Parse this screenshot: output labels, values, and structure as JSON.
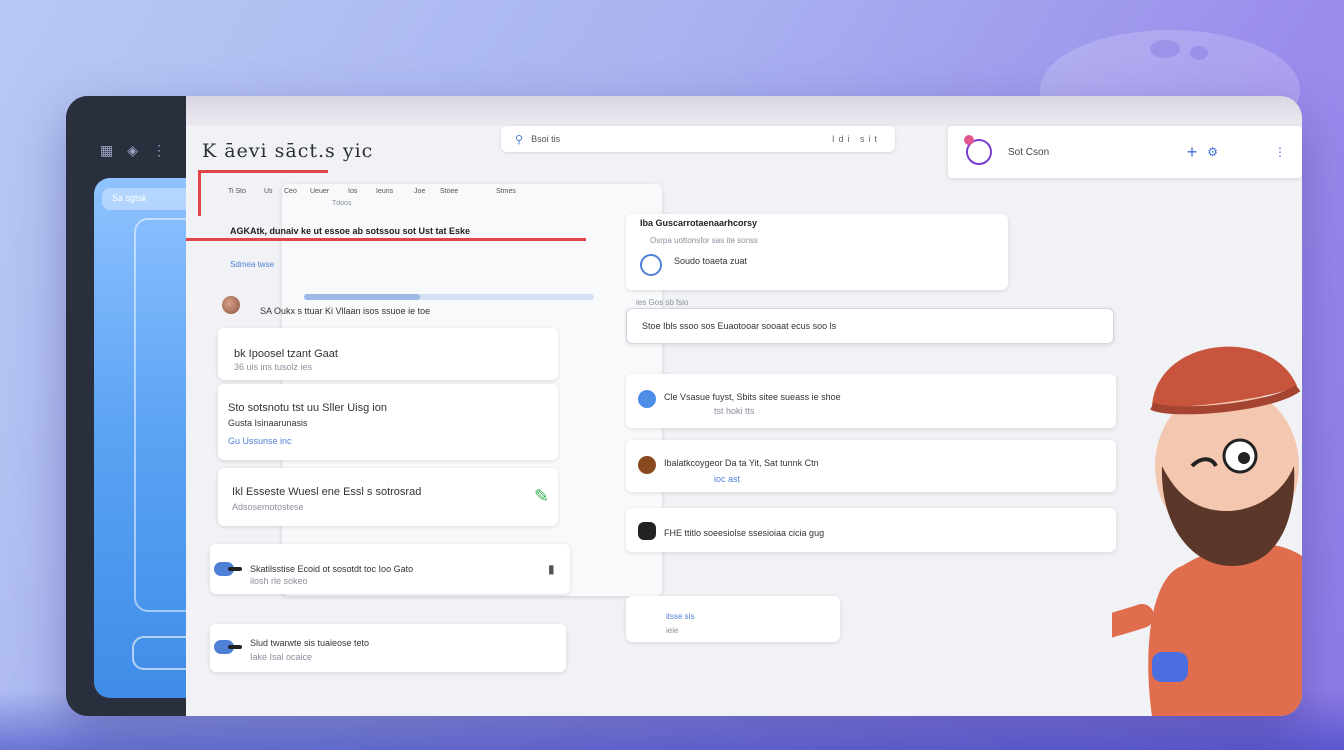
{
  "colors": {
    "accent": "#4f80d8",
    "highlight": "#e0454a",
    "success": "#37b24d"
  },
  "app": {
    "title": "K āevi sāct.s yic"
  },
  "search": {
    "icon": "search-icon",
    "placeholder": "Bsoi tis",
    "right": "Idi sit"
  },
  "user": {
    "name": "Sot Cson",
    "add_icon": "plus-icon",
    "settings_icon": "settings-icon",
    "more_icon": "more-icon"
  },
  "left_sidebar": {
    "top_label": "Sa sgtsk"
  },
  "list_tabs": [
    "Ti Sto",
    "Us",
    "Ceo",
    "Ueuer",
    "Ios",
    "Ieuns",
    "Joe",
    "Stoee",
    "Stmes"
  ],
  "list_subtitle": "Tdoos",
  "list_highlight": "AGKAtk, dunaiv ke ut essoe ab sotssou sot Ust tat Eske",
  "list_meta": "Sdmea twse",
  "list_items": [
    {
      "title": "SA Oukx s ttuar Ki Vllaan isos ssuoe ie toe",
      "sub": ""
    },
    {
      "title": "bk Ipoosel tzant Gaat",
      "sub": "36 uis ins tusolz ies"
    },
    {
      "title": "Sto sotsnotu tst uu Sller Uisg ion",
      "sub": "Gusta Isinaarunasis",
      "meta": "Gu Ussunse inc"
    },
    {
      "title": "Ikl Esseste Wuesl ene Essl s sotrosrad",
      "sub": "Adsosemotostese"
    }
  ],
  "left_cards": [
    {
      "title": "Skatilsstise Ecoid ot sosotdt toc Ioo Gato",
      "sub": "ilosh rle sokeo"
    },
    {
      "title": "Slud twarwte sis tuaieose teto",
      "sub": "Iake Isal ocaice"
    }
  ],
  "feed_header": {
    "title": "Iba Guscarrotaenaarhcorsy",
    "sub": "Osrpa uottonsfor sas ite sonss",
    "item": "Soudo toaeta zuat"
  },
  "feed_row_meta": "ies Gos sb fsio",
  "feed_input": "Stoe Ibls ssoo sos Euaotooar sooaat ecus soo ls",
  "feed_items": [
    {
      "title": "Cle Vsasue fuyst, Sbits sitee sueass ie shoe",
      "sub": "tst hoki tts"
    },
    {
      "title": "Ibalatkcoygeor Da ta Yit, Sat tunnk Ctn",
      "sub": "ioc ast"
    },
    {
      "title": "FHE ttitlo soeesiolse ssesioiaa cicia gug",
      "sub": ""
    }
  ],
  "feed_bottom": {
    "title": "itsse sis",
    "sub": "ieie"
  }
}
